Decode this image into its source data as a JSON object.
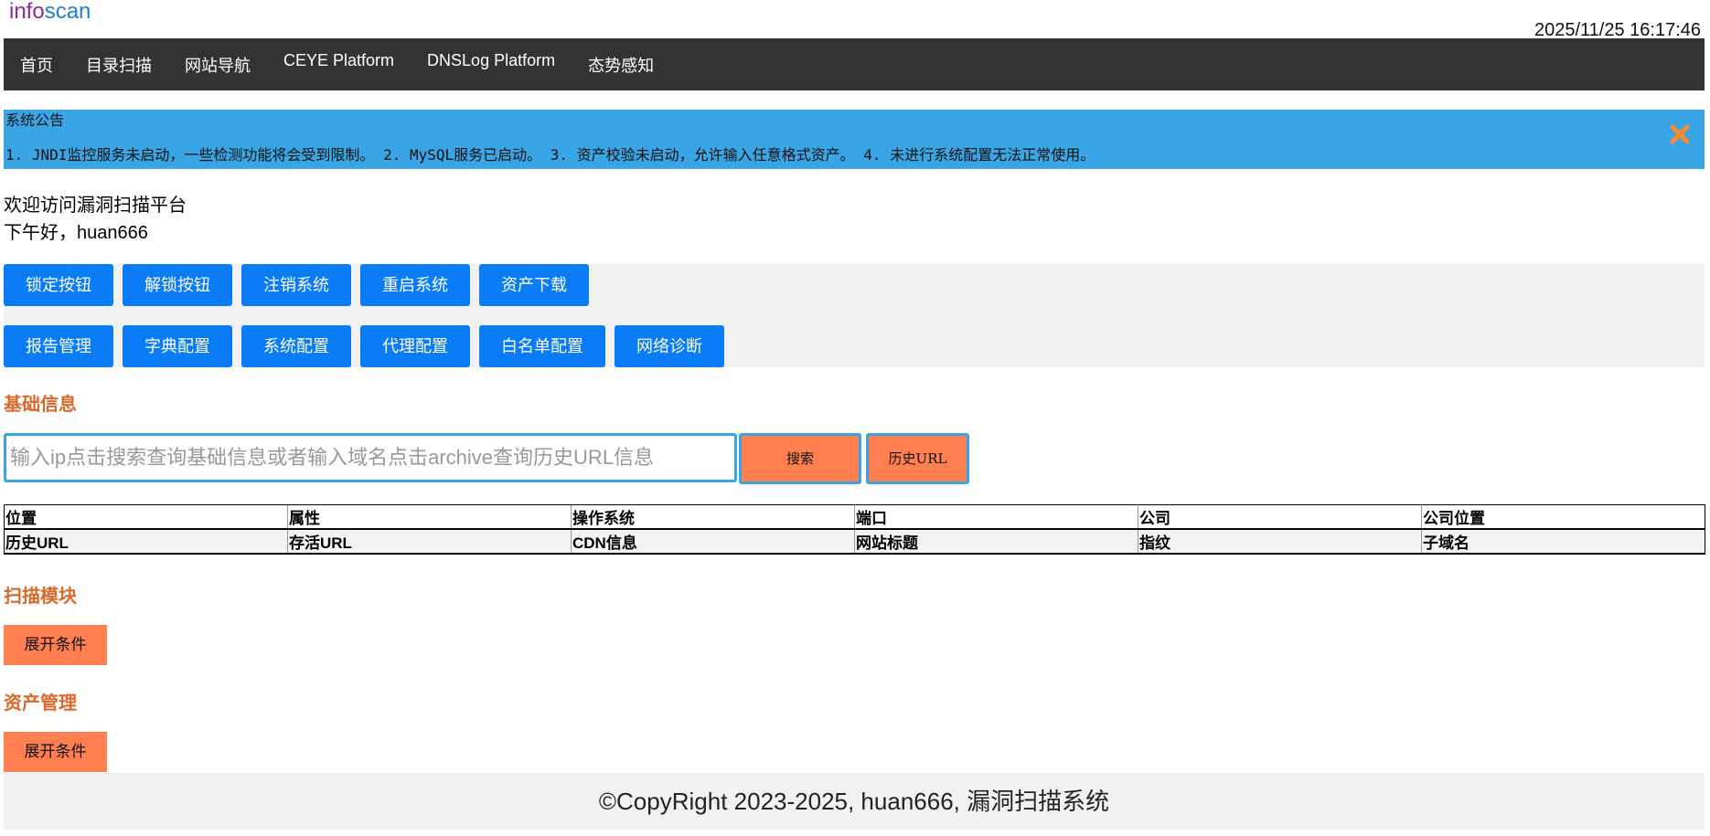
{
  "header": {
    "logo_part1": "info",
    "logo_part2": "scan",
    "datetime": "2025/11/25 16:17:46"
  },
  "nav": {
    "items": [
      {
        "label": "首页"
      },
      {
        "label": "目录扫描"
      },
      {
        "label": "网站导航"
      },
      {
        "label": "CEYE Platform"
      },
      {
        "label": "DNSLog Platform"
      },
      {
        "label": "态势感知"
      }
    ]
  },
  "announcement": {
    "title": "系统公告",
    "body": "1. JNDI监控服务未启动，一些检测功能将会受到限制。 2. MySQL服务已启动。 3. 资产校验未启动，允许输入任意格式资产。 4. 未进行系统配置无法正常使用。",
    "close_icon": "close-icon",
    "close_color": "#ff8a2a",
    "background": "#3aa5e4"
  },
  "welcome": {
    "line1": "欢迎访问漏洞扫描平台",
    "line2": "下午好，huan666"
  },
  "buttons": {
    "row1": [
      "锁定按钮",
      "解锁按钮",
      "注销系统",
      "重启系统",
      "资产下载"
    ],
    "row2": [
      "报告管理",
      "字典配置",
      "系统配置",
      "代理配置",
      "白名单配置",
      "网络诊断"
    ],
    "color": "#0a7cf5"
  },
  "basic_info": {
    "title": "基础信息",
    "search_placeholder": "输入ip点击搜索查询基础信息或者输入域名点击archive查询历史URL信息",
    "search_button": "搜索",
    "history_button": "历史URL",
    "table": {
      "row1": [
        "位置",
        "属性",
        "操作系统",
        "端口",
        "公司",
        "公司位置"
      ],
      "row2": [
        "历史URL",
        "存活URL",
        "CDN信息",
        "网站标题",
        "指纹",
        "子域名"
      ]
    }
  },
  "scan_module": {
    "title": "扫描模块",
    "expand_button": "展开条件"
  },
  "asset_management": {
    "title": "资产管理",
    "expand_button": "展开条件"
  },
  "footer": {
    "text": "©CopyRight 2023-2025, huan666, 漏洞扫描系统"
  }
}
